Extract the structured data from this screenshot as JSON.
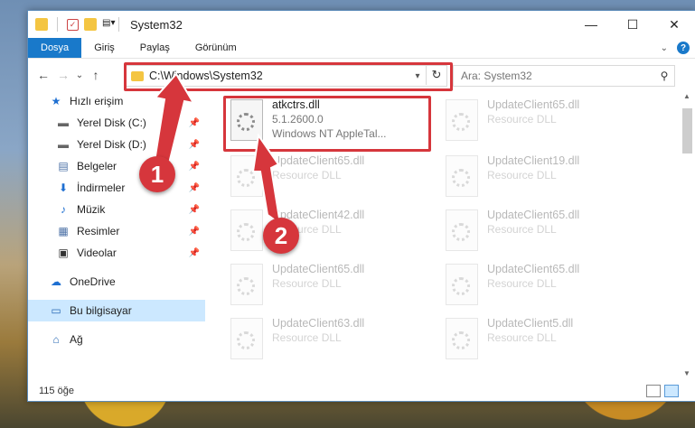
{
  "window": {
    "title": "System32",
    "controls": {
      "minimize": "—",
      "maximize": "☐",
      "close": "✕"
    }
  },
  "ribbon": {
    "tabs": [
      "Dosya",
      "Giriş",
      "Paylaş",
      "Görünüm"
    ],
    "expand_icon": "chevron-down-icon",
    "help_label": "?"
  },
  "nav": {
    "back": "←",
    "forward": "→",
    "recent": "⌄",
    "up": "↑",
    "address": "C:\\Windows\\System32",
    "refresh": "↻",
    "search_placeholder": "Ara: System32",
    "search_icon": "⚲"
  },
  "sidebar": {
    "items": [
      {
        "label": "Hızlı erişim",
        "icon": "star-icon",
        "glyph": "★",
        "color": "#1e6fd1",
        "pinned": false
      },
      {
        "label": "Yerel Disk (C:)",
        "icon": "drive-icon",
        "glyph": "▬",
        "color": "#666666",
        "pinned": true
      },
      {
        "label": "Yerel Disk (D:)",
        "icon": "drive-icon",
        "glyph": "▬",
        "color": "#666666",
        "pinned": true
      },
      {
        "label": "Belgeler",
        "icon": "documents-icon",
        "glyph": "▤",
        "color": "#4a6fa5",
        "pinned": true
      },
      {
        "label": "İndirmeler",
        "icon": "downloads-icon",
        "glyph": "⬇",
        "color": "#1e6fd1",
        "pinned": true
      },
      {
        "label": "Müzik",
        "icon": "music-icon",
        "glyph": "♪",
        "color": "#1e6fd1",
        "pinned": true
      },
      {
        "label": "Resimler",
        "icon": "pictures-icon",
        "glyph": "▦",
        "color": "#4a6fa5",
        "pinned": true
      },
      {
        "label": "Videolar",
        "icon": "videos-icon",
        "glyph": "▣",
        "color": "#333333",
        "pinned": true
      },
      {
        "label": "OneDrive",
        "icon": "cloud-icon",
        "glyph": "☁",
        "color": "#1e6fd1",
        "pinned": false
      },
      {
        "label": "Bu bilgisayar",
        "icon": "computer-icon",
        "glyph": "▭",
        "color": "#2a6ab5",
        "pinned": false,
        "selected": true
      },
      {
        "label": "Ağ",
        "icon": "network-icon",
        "glyph": "⌂",
        "color": "#2a6ab5",
        "pinned": false
      }
    ],
    "pin_glyph": "📌"
  },
  "files": [
    {
      "name": "atkctrs.dll",
      "line2": "5.1.2600.0",
      "line3": "Windows NT AppleTal...",
      "faded": false
    },
    {
      "name": "UpdateClient65.dll",
      "line2": "Resource DLL",
      "faded": true
    },
    {
      "name": "UpdateClient65.dll",
      "line2": "Resource DLL",
      "faded": true
    },
    {
      "name": "UpdateClient19.dll",
      "line2": "Resource DLL",
      "faded": true
    },
    {
      "name": "UpdateClient42.dll",
      "line2": "Resource DLL",
      "faded": true
    },
    {
      "name": "UpdateClient65.dll",
      "line2": "Resource DLL",
      "faded": true
    },
    {
      "name": "UpdateClient65.dll",
      "line2": "Resource DLL",
      "faded": true
    },
    {
      "name": "UpdateClient65.dll",
      "line2": "Resource DLL",
      "faded": true
    },
    {
      "name": "UpdateClient63.dll",
      "line2": "Resource DLL",
      "faded": true
    },
    {
      "name": "UpdateClient5.dll",
      "line2": "Resource DLL",
      "faded": true
    }
  ],
  "status": {
    "count": "115 öğe"
  },
  "annotations": {
    "step1": "1",
    "step2": "2",
    "color": "#d6363c"
  }
}
